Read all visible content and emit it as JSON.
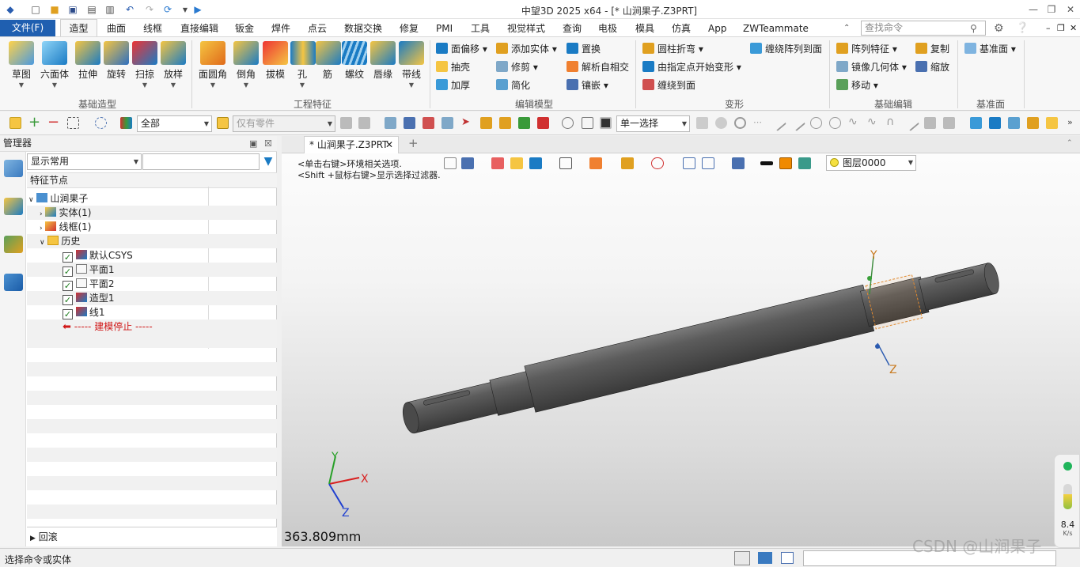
{
  "app": {
    "title": "中望3D 2025 x64 - [* 山涧果子.Z3PRT]"
  },
  "menubar": {
    "file": "文件(F)",
    "tabs": [
      "造型",
      "曲面",
      "线框",
      "直接编辑",
      "钣金",
      "焊件",
      "点云",
      "数据交换",
      "修复",
      "PMI",
      "工具",
      "视觉样式",
      "查询",
      "电极",
      "模具",
      "仿真",
      "App",
      "ZWTeammate"
    ],
    "active_tab": "造型",
    "search_placeholder": "查找命令"
  },
  "ribbon": {
    "groups": [
      "基础造型",
      "工程特征",
      "编辑模型",
      "变形",
      "基础编辑",
      "基准面"
    ],
    "basic": [
      "草图",
      "六面体",
      "拉伸",
      "旋转",
      "扫掠",
      "放样"
    ],
    "engineering": [
      "面圆角",
      "倒角",
      "拔模",
      "孔",
      "筋",
      "螺纹",
      "唇缘",
      "带线"
    ],
    "edit_model": [
      "面偏移",
      "抽壳",
      "加厚",
      "添加实体",
      "修剪",
      "简化",
      "置换",
      "解析自相交",
      "镶嵌"
    ],
    "deform": [
      "圆柱折弯",
      "由指定点开始变形",
      "缠绕到面",
      "缠绕阵列到面"
    ],
    "basic_edit": [
      "阵列特征",
      "镜像几何体",
      "移动",
      "复制",
      "缩放"
    ],
    "datum": [
      "基准面"
    ]
  },
  "toolbar2": {
    "filter_value": "全部",
    "part_filter": "仅有零件",
    "select_mode": "单一选择"
  },
  "manager": {
    "title": "管理器",
    "filter_value": "显示常用",
    "header": "特征节点",
    "tree": [
      {
        "label": "山涧果子",
        "level": 0
      },
      {
        "label": "实体(1)",
        "level": 1
      },
      {
        "label": "线框(1)",
        "level": 1
      },
      {
        "label": "历史",
        "level": 1
      },
      {
        "label": "默认CSYS",
        "level": 2
      },
      {
        "label": "平面1",
        "level": 2
      },
      {
        "label": "平面2",
        "level": 2
      },
      {
        "label": "造型1",
        "level": 2
      },
      {
        "label": "线1",
        "level": 2
      }
    ],
    "stop_marker": "----- 建模停止 -----",
    "footer": "回滚"
  },
  "viewport": {
    "doc_tab": "* 山涧果子.Z3PRT",
    "hint_1": "<单击右键>环境相关选项.",
    "hint_2": "<Shift +鼠标右键>显示选择过滤器.",
    "layer": "图层0000",
    "measure": "363.809mm",
    "axis_x": "X",
    "axis_y": "Y",
    "axis_z": "Z",
    "gauge_value": "8.4",
    "gauge_unit": "K/s"
  },
  "status": {
    "text": "选择命令或实体"
  },
  "watermark": "CSDN @山涧果子"
}
